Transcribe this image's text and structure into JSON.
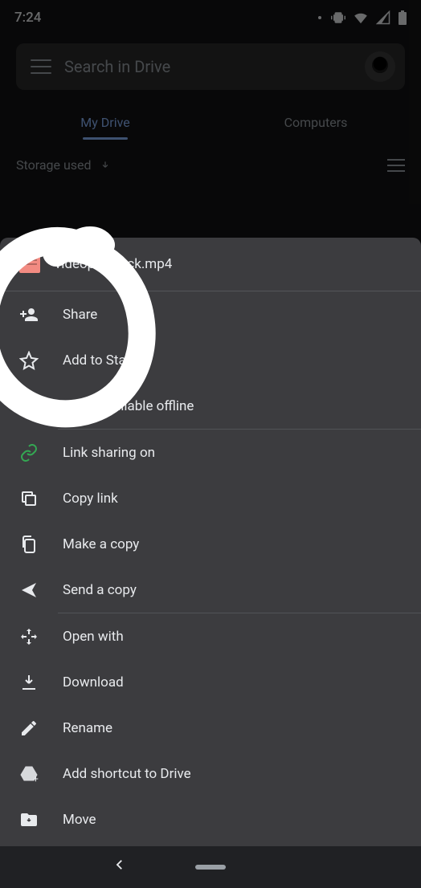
{
  "status": {
    "time": "7:24"
  },
  "search": {
    "placeholder": "Search in Drive"
  },
  "tabs": {
    "myDrive": "My Drive",
    "computers": "Computers"
  },
  "subheader": {
    "sort": "Storage used"
  },
  "sheet": {
    "file_name": "videoplayback.mp4",
    "share": "Share",
    "add_to_starred": "Add to Starred",
    "make_offline": "Make available offline",
    "link_sharing": "Link sharing on",
    "copy_link": "Copy link",
    "make_a_copy": "Make a copy",
    "send_a_copy": "Send a copy",
    "open_with": "Open with",
    "download": "Download",
    "rename": "Rename",
    "add_shortcut": "Add shortcut to Drive",
    "move": "Move"
  }
}
